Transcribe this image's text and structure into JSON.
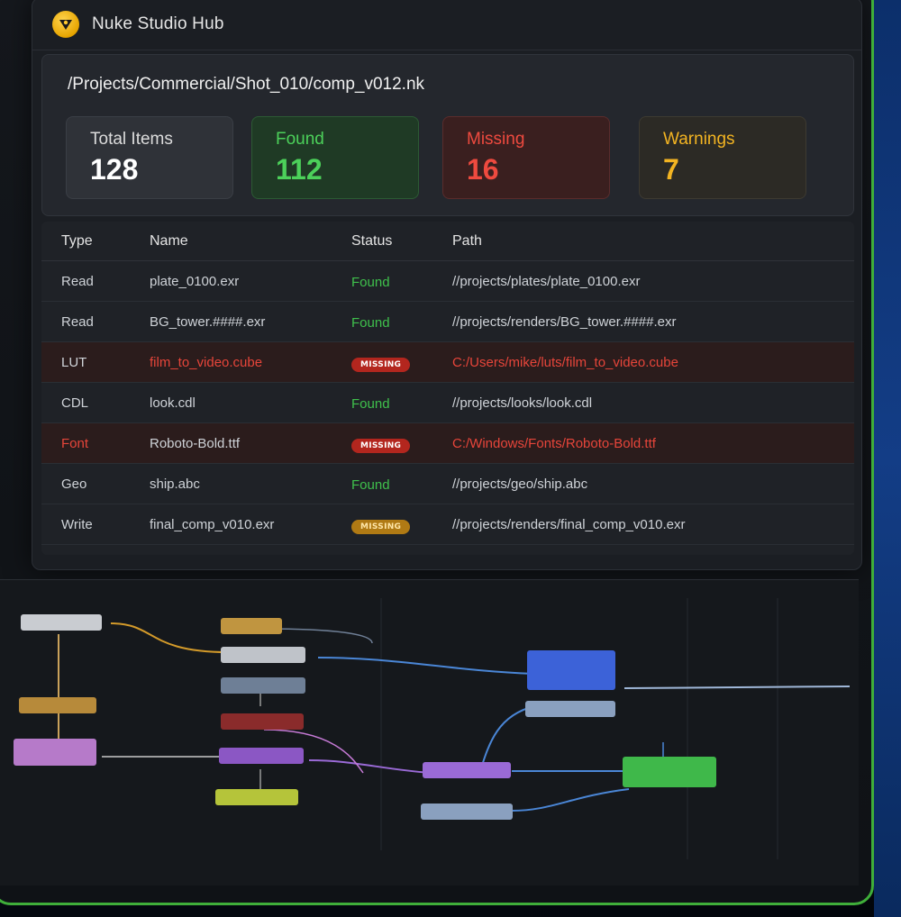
{
  "app": {
    "title": "Nuke Studio Hub"
  },
  "project_path": "/Projects/Commercial/Shot_010/comp_v012.nk",
  "summary": {
    "total": {
      "label": "Total Items",
      "value": "128"
    },
    "found": {
      "label": "Found",
      "value": "112"
    },
    "missing": {
      "label": "Missing",
      "value": "16"
    },
    "warnings": {
      "label": "Warnings",
      "value": "7"
    }
  },
  "table": {
    "headers": {
      "type": "Type",
      "name": "Name",
      "status": "Status",
      "path": "Path"
    },
    "rows": [
      {
        "type": "Read",
        "name": "plate_0100.exr",
        "status": "Found",
        "path": "//projects/plates/plate_0100.exr"
      },
      {
        "type": "Read",
        "name": "BG_tower.####.exr",
        "status": "Found",
        "path": "//projects/renders/BG_tower.####.exr"
      },
      {
        "type": "LUT",
        "name": "film_to_video.cube",
        "status": "MISSING",
        "path": "C:/Users/mike/luts/film_to_video.cube"
      },
      {
        "type": "CDL",
        "name": "look.cdl",
        "status": "Found",
        "path": "//projects/looks/look.cdl"
      },
      {
        "type": "Font",
        "name": "Roboto-Bold.ttf",
        "status": "MISSING",
        "path": "C:/Windows/Fonts/Roboto-Bold.ttf"
      },
      {
        "type": "Geo",
        "name": "ship.abc",
        "status": "Found",
        "path": "//projects/geo/ship.abc"
      },
      {
        "type": "Write",
        "name": "final_comp_v010.exr",
        "status": "MISSING",
        "path": "//projects/renders/final_comp_v010.exr"
      }
    ]
  },
  "colors": {
    "found": "#3fc04c",
    "missing": "#e6453a",
    "warning": "#f3b422",
    "frame_accent": "#3fae3a"
  },
  "icons": {
    "logo": "nuke-logo-icon"
  }
}
